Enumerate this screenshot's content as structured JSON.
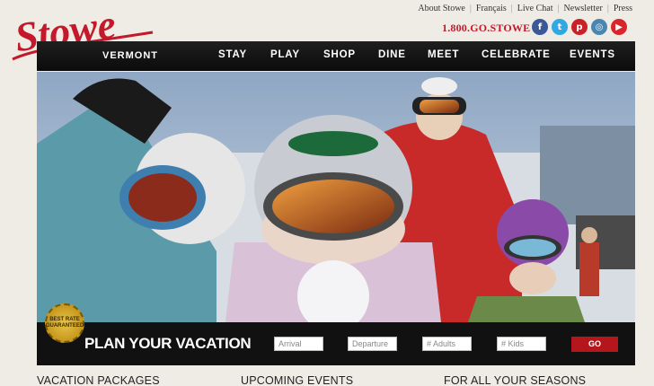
{
  "brand": {
    "logo_text": "Stowe",
    "region": "VERMONT"
  },
  "top_links": [
    "About Stowe",
    "Français",
    "Live Chat",
    "Newsletter",
    "Press"
  ],
  "phone": "1.800.GO.STOWE",
  "social": [
    {
      "name": "facebook-icon",
      "glyph": "f",
      "color": "#3b5998"
    },
    {
      "name": "twitter-icon",
      "glyph": "t",
      "color": "#2fa8e3"
    },
    {
      "name": "pinterest-icon",
      "glyph": "p",
      "color": "#cb2027"
    },
    {
      "name": "instagram-icon",
      "glyph": "◎",
      "color": "#4a86b0"
    },
    {
      "name": "youtube-icon",
      "glyph": "▶",
      "color": "#d9262b"
    }
  ],
  "nav": [
    "STAY",
    "PLAY",
    "SHOP",
    "DINE",
    "MEET",
    "CELEBRATE",
    "EVENTS"
  ],
  "booking": {
    "title": "PLAN YOUR VACATION",
    "arrival_placeholder": "Arrival",
    "departure_placeholder": "Departure",
    "adults_placeholder": "# Adults",
    "kids_placeholder": "# Kids",
    "go_label": "GO",
    "seal": [
      "BEST RATE",
      "GUARANTEED"
    ]
  },
  "sections": [
    "VACATION PACKAGES",
    "UPCOMING EVENTS",
    "FOR ALL YOUR SEASONS"
  ],
  "colors": {
    "accent": "#c3192a",
    "navbar": "#111111",
    "background": "#efece6"
  }
}
